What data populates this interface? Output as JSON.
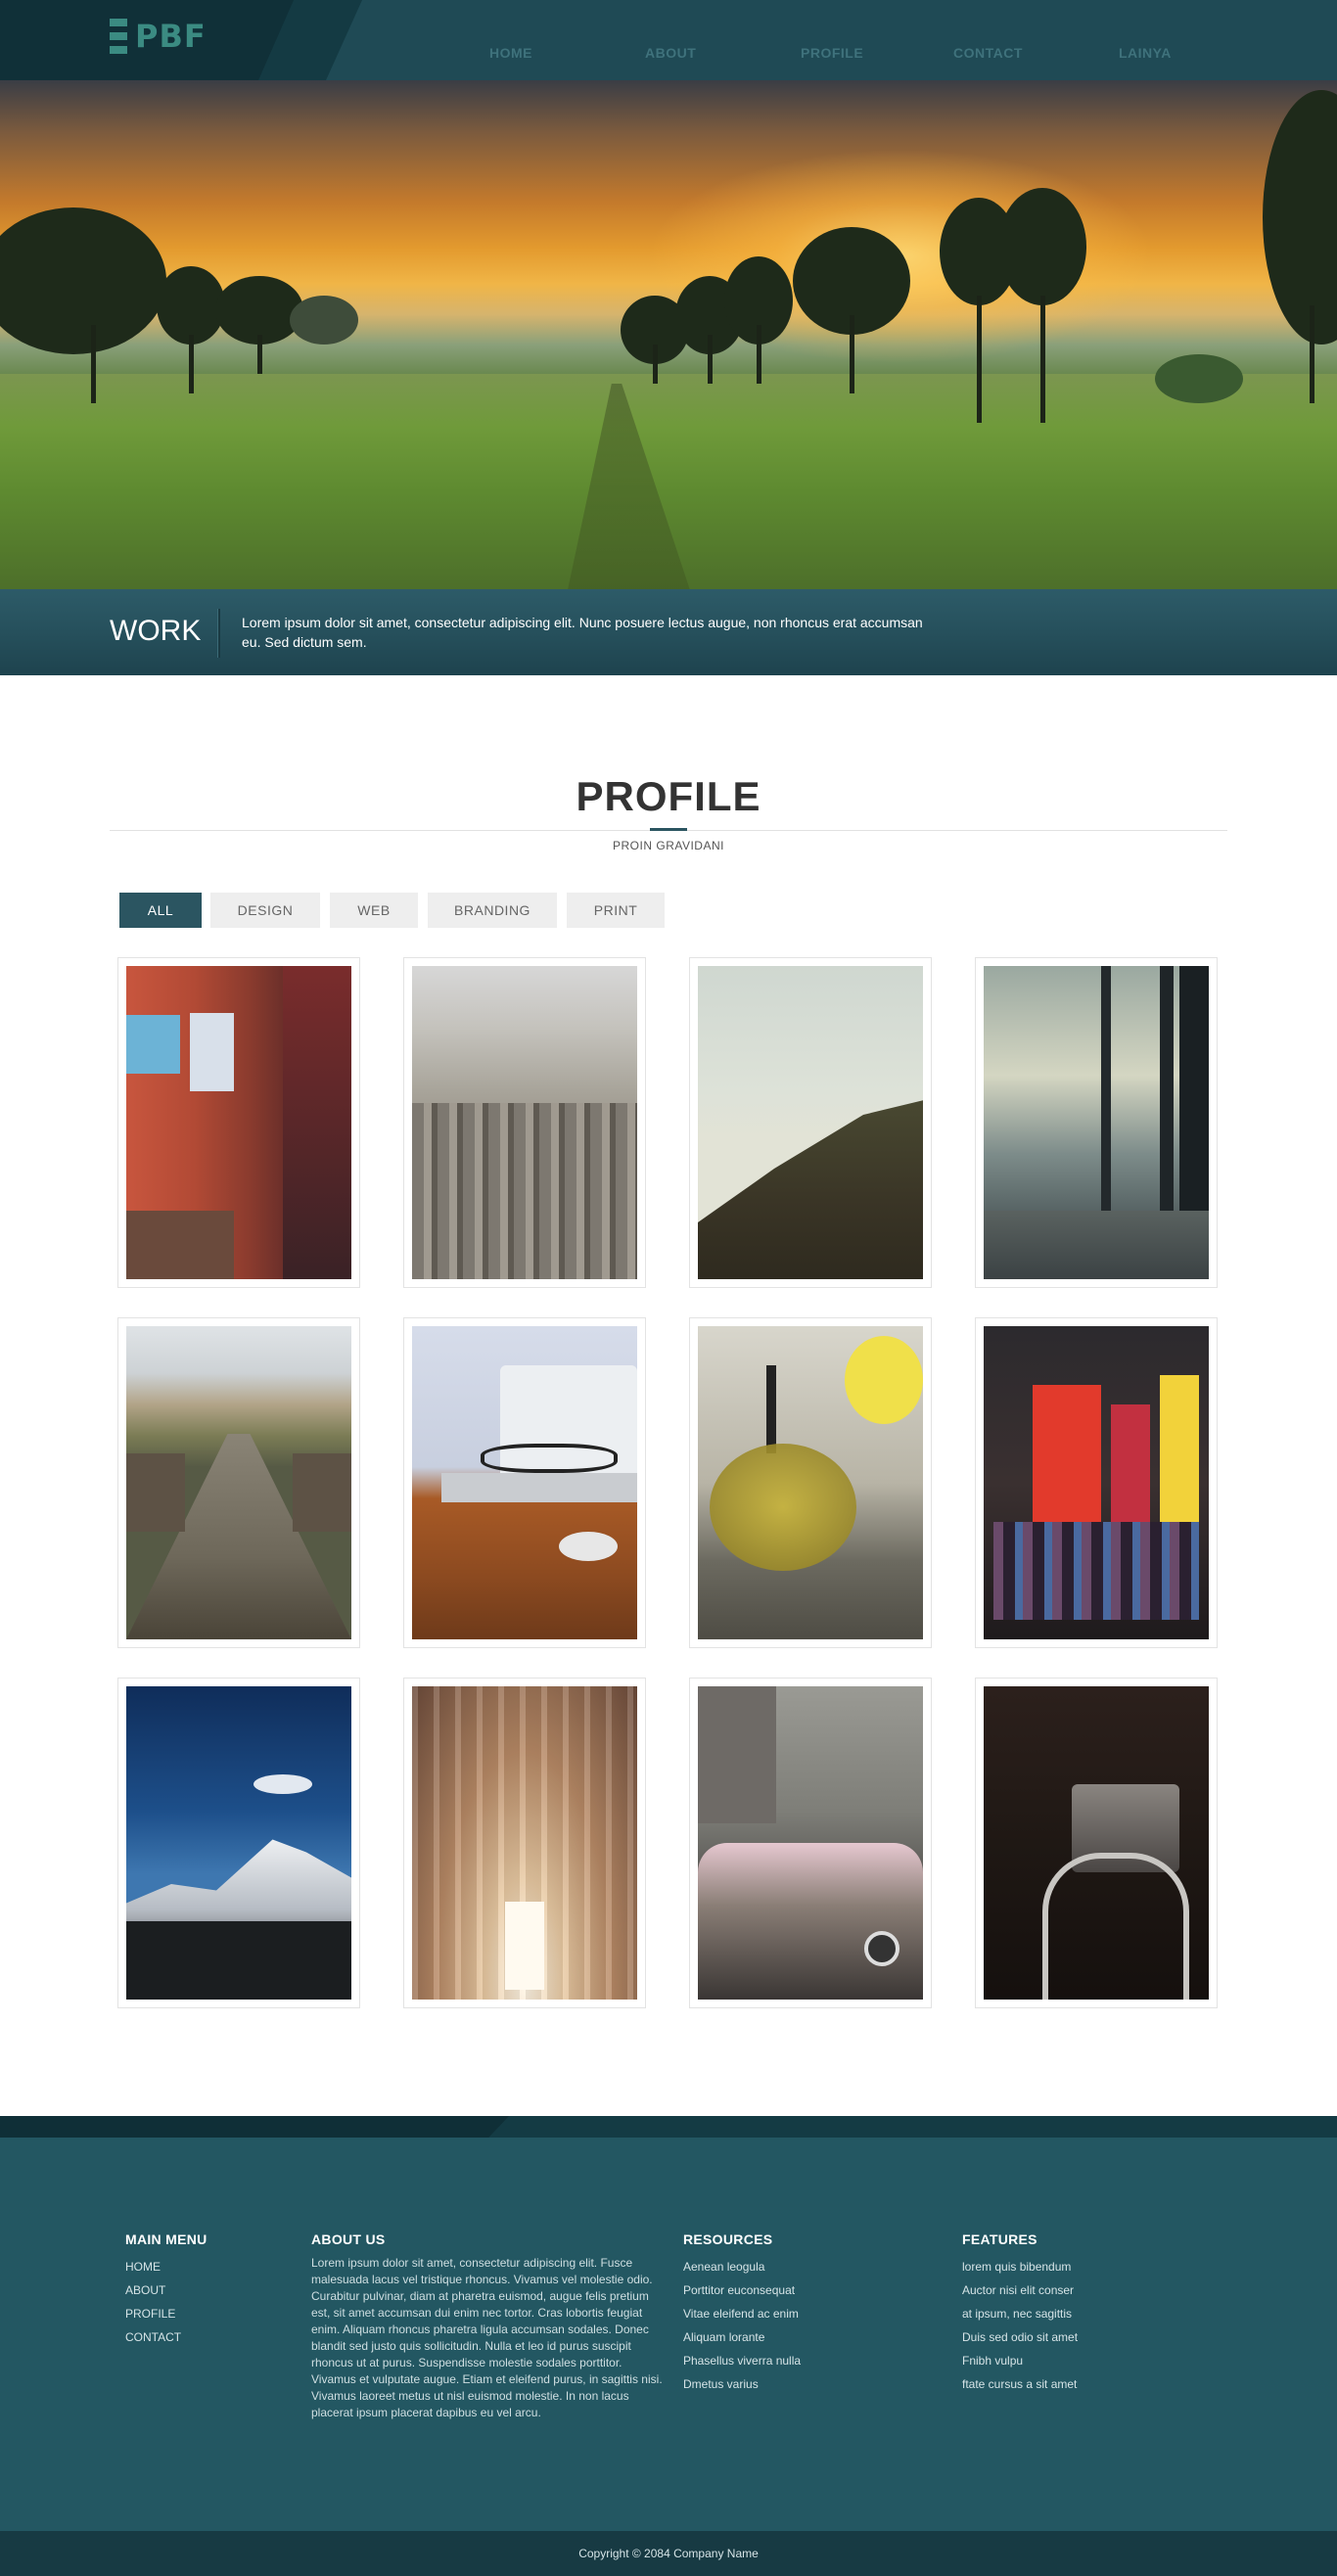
{
  "nav": {
    "logo": "PBF",
    "links": [
      "HOME",
      "ABOUT",
      "PROFILE",
      "CONTACT",
      "LAINYA"
    ]
  },
  "hero": {
    "image": "sunset-field-with-trees"
  },
  "work": {
    "title": "WORK",
    "text": "Lorem ipsum dolor sit amet, consectetur adipiscing elit. Nunc posuere lectus augue, non rhoncus erat accumsan eu. Sed dictum sem."
  },
  "profile": {
    "title": "PROFILE",
    "subtitle": "PROIN GRAVIDANI",
    "filters": [
      "ALL",
      "DESIGN",
      "WEB",
      "BRANDING",
      "PRINT"
    ],
    "active_filter": "ALL",
    "gallery": [
      "colorful-old-buildings-laundry",
      "hazy-city-skyline-aerial",
      "green-hill-under-pale-sky",
      "misty-forest-path",
      "wooden-boardwalk-to-beach",
      "eyeglasses-on-laptop-desk",
      "tea-press-with-yellow-flowers",
      "kodak-neon-signs-at-night",
      "snowy-mountain-blue-sky",
      "cathedral-vaulted-ceiling",
      "rusty-vintage-car",
      "dark-vintage-projector"
    ]
  },
  "footer": {
    "main_menu": {
      "title": "MAIN MENU",
      "items": [
        "HOME",
        "ABOUT",
        "PROFILE",
        "CONTACT"
      ]
    },
    "about": {
      "title": "ABOUT US",
      "text": "Lorem ipsum dolor sit amet, consectetur adipiscing elit. Fusce malesuada lacus vel tristique rhoncus. Vivamus vel molestie odio. Curabitur pulvinar, diam at pharetra euismod, augue felis pretium est, sit amet accumsan dui enim nec tortor. Cras lobortis feugiat enim. Aliquam rhoncus pharetra ligula accumsan sodales. Donec blandit sed justo quis sollicitudin. Nulla et leo id purus suscipit rhoncus ut at purus. Suspendisse molestie sodales porttitor. Vivamus et vulputate augue. Etiam et eleifend purus, in sagittis nisi. Vivamus laoreet metus ut nisl euismod molestie. In non lacus placerat ipsum placerat dapibus eu vel arcu."
    },
    "resources": {
      "title": "RESOURCES",
      "items": [
        "Aenean leogula",
        "Porttitor euconsequat",
        "Vitae eleifend ac enim",
        "Aliquam lorante",
        "Phasellus viverra nulla",
        "Dmetus varius"
      ]
    },
    "features": {
      "title": "FEATURES",
      "items": [
        "lorem quis bibendum",
        "Auctor nisi elit conser",
        "at ipsum, nec sagittis",
        "Duis sed odio sit amet",
        "Fnibh vulpu",
        "ftate cursus a sit amet"
      ]
    },
    "copyright": "Copyright © 2084 Company Name"
  },
  "colors": {
    "nav_bg": "#1f4a55",
    "accent": "#2b5561",
    "logo": "#3b8b82",
    "footer_bg": "#235762",
    "copyright_bg": "#173a43"
  }
}
